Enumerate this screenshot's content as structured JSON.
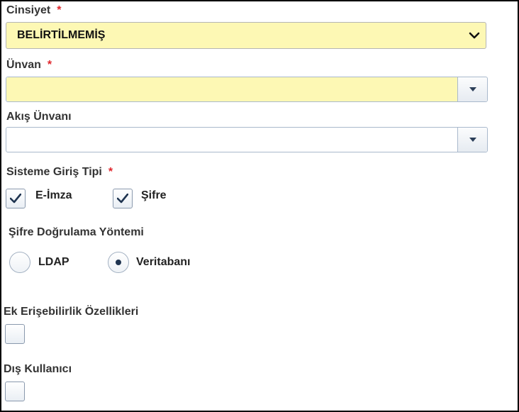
{
  "form": {
    "gender": {
      "label": "Cinsiyet",
      "required_mark": "*",
      "selected": "BELİRTİLMEMİŞ"
    },
    "title": {
      "label": "Ünvan",
      "required_mark": "*",
      "value": ""
    },
    "flow_title": {
      "label": "Akış Ünvanı",
      "value": ""
    },
    "login_type": {
      "label": "Sisteme Giriş Tipi",
      "required_mark": "*",
      "options": [
        {
          "label": "E-İmza",
          "checked": true
        },
        {
          "label": "Şifre",
          "checked": true
        }
      ]
    },
    "password_validation": {
      "label": "Şifre Doğrulama Yöntemi",
      "options": [
        {
          "label": "LDAP",
          "selected": false
        },
        {
          "label": "Veritabanı",
          "selected": true
        }
      ]
    },
    "accessibility": {
      "label": "Ek Erişebilirlik Özellikleri",
      "checked": false
    },
    "external_user": {
      "label": "Dış Kullanıcı",
      "checked": false
    }
  },
  "colors": {
    "required": "#e0262c",
    "mandatory_field_bg": "#fdf8b4",
    "check_mark": "#1f3450"
  }
}
